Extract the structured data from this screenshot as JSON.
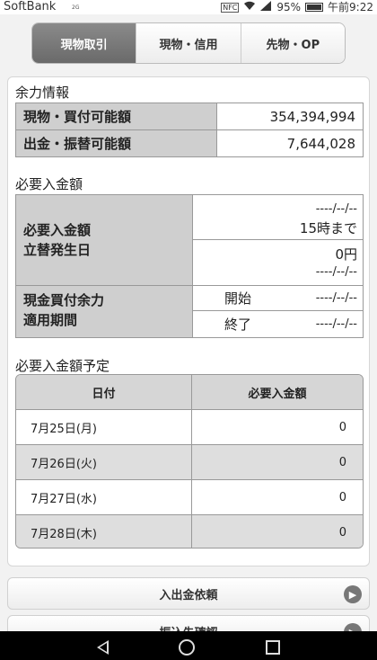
{
  "status_bar": {
    "carrier": "SoftBank",
    "carrier_sub": "2G",
    "nfc": "NFC",
    "battery": "95%",
    "time": "午前9:22"
  },
  "tabs": [
    {
      "label": "現物取引",
      "active": true
    },
    {
      "label": "現物・信用",
      "active": false
    },
    {
      "label": "先物・OP",
      "active": false
    }
  ],
  "margin_info": {
    "title": "余力情報",
    "rows": [
      {
        "label": "現物・買付可能額",
        "value": "354,394,994"
      },
      {
        "label": "出金・振替可能額",
        "value": "7,644,028"
      }
    ]
  },
  "required_deposit": {
    "title": "必要入金額",
    "label_amount": "必要入金額",
    "label_date": "立替発生日",
    "date_top": "----/--/--",
    "deadline": "15時まで",
    "amount": "0円",
    "date_bottom": "----/--/--",
    "label_cash": "現金買付余力",
    "label_period": "適用期間",
    "start_label": "開始",
    "start_value": "----/--/--",
    "end_label": "終了",
    "end_value": "----/--/--"
  },
  "schedule": {
    "title": "必要入金額予定",
    "col_date": "日付",
    "col_amount": "必要入金額",
    "rows": [
      {
        "date": "7月25日(月)",
        "amount": "0"
      },
      {
        "date": "7月26日(火)",
        "amount": "0"
      },
      {
        "date": "7月27日(水)",
        "amount": "0"
      },
      {
        "date": "7月28日(木)",
        "amount": "0"
      }
    ]
  },
  "buttons": {
    "deposit_request": "入出金依頼",
    "transfer_confirm": "振込先確認"
  }
}
